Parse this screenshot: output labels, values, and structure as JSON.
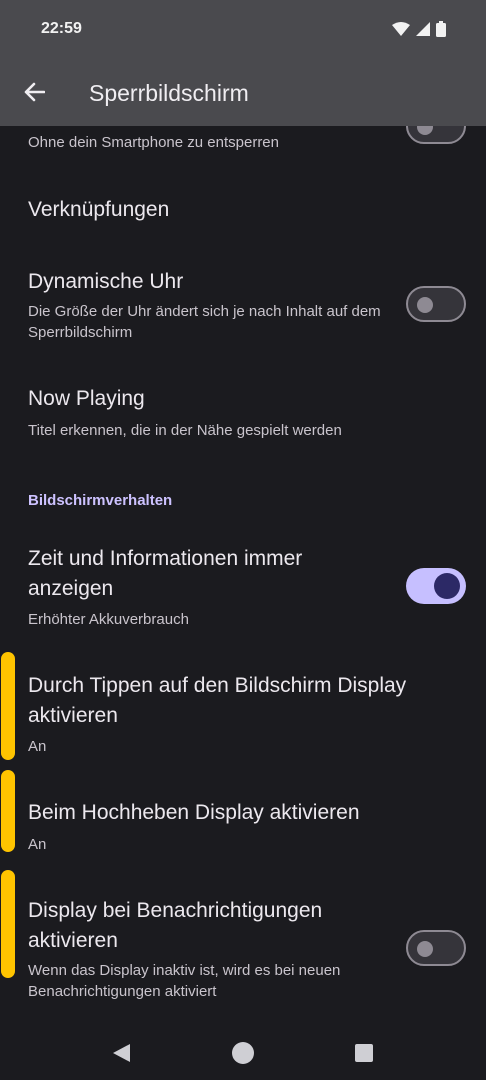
{
  "status": {
    "time": "22:59",
    "icons": [
      "wifi-icon",
      "signal-icon",
      "battery-icon"
    ]
  },
  "appbar": {
    "back_icon": "arrow-left-icon",
    "title": "Sperrbildschirm"
  },
  "items": [
    {
      "title": "",
      "subtitle": "Ohne dein Smartphone zu entsperren",
      "toggle": "off"
    },
    {
      "title": "Verknüpfungen",
      "subtitle": ""
    },
    {
      "title": "Dynamische Uhr",
      "subtitle": "Die Größe der Uhr ändert sich je nach Inhalt auf dem Sperrbildschirm",
      "toggle": "off"
    },
    {
      "title": "Now Playing",
      "subtitle": "Titel erkennen, die in der Nähe gespielt werden"
    },
    {
      "title": "Zeit und Informationen immer anzeigen",
      "subtitle": "Erhöhter Akkuverbrauch",
      "toggle": "on"
    },
    {
      "title": "Durch Tippen auf den Bildschirm Display aktivieren",
      "subtitle": "An"
    },
    {
      "title": "Beim Hochheben Display aktivieren",
      "subtitle": "An"
    },
    {
      "title": "Display bei Benachrichtigungen aktivieren",
      "subtitle": "Wenn das Display inaktiv ist, wird es bei neuen Benachrichtigungen aktiviert",
      "toggle": "off"
    }
  ],
  "section_header": "Bildschirmverhalten",
  "colors": {
    "background": "#1b1b1f",
    "bar": "#4a4a4e",
    "accent": "#c6bfff",
    "annotation": "#ffc400"
  },
  "navbar": {
    "icons": [
      "back-triangle-icon",
      "home-circle-icon",
      "recents-square-icon"
    ]
  }
}
